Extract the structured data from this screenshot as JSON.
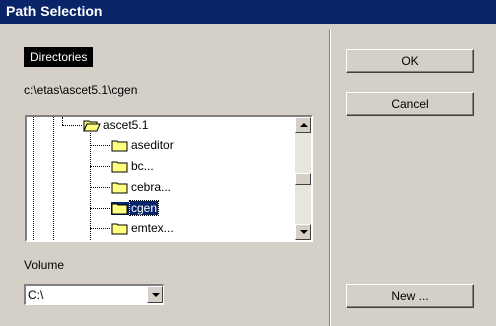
{
  "window": {
    "title": "Path Selection"
  },
  "directories": {
    "label": "Directories",
    "current_path": "c:\\etas\\ascet5.1\\cgen",
    "tree": {
      "parent": "ascet5.1",
      "children": [
        "aseditor",
        "bc...",
        "cebra...",
        "cgen",
        "emtex..."
      ],
      "selected": "cgen"
    }
  },
  "volume": {
    "label": "Volume",
    "value": "C:\\"
  },
  "buttons": {
    "ok": "OK",
    "cancel": "Cancel",
    "new": "New ..."
  }
}
